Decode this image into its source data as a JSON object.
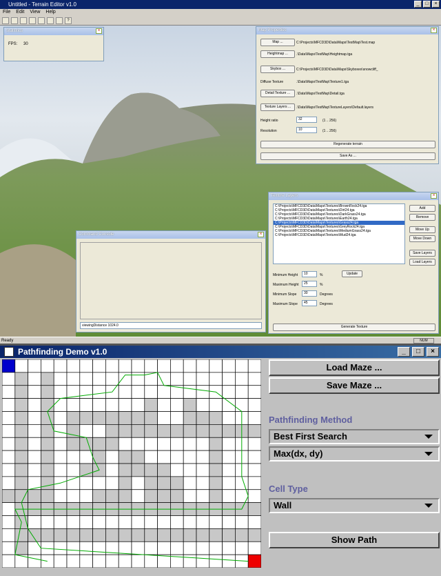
{
  "editor": {
    "title": "Untitled - Terrain Editor v1.0",
    "menu": [
      "File",
      "Edit",
      "View",
      "Help"
    ],
    "status": "Ready",
    "num": "NUM"
  },
  "stats": {
    "title": "Statistics",
    "fps_label": "FPS:",
    "fps_value": "30"
  },
  "props": {
    "title": "Map Properties",
    "map_btn": "Map ...",
    "map_val": "C:\\Projects\\MFCD3D\\Data\\Maps\\TestMap\\Test.map",
    "height_btn": "Heightmap ...",
    "height_val": ".\\Data\\Maps\\TestMap\\Heightmap.tga",
    "sky_btn": "Skybox ...",
    "sky_val": "C:\\Projects\\MFCD3D\\Data\\Maps\\Skyboxes\\snowcliff_",
    "diffuse_lbl": "Diffuse Texture",
    "diffuse_val": ".\\Data\\Maps\\TestMap\\Texture1.tga",
    "detail_btn": "Detail Texture ...",
    "detail_val": ".\\Data\\Maps\\TestMap\\Detail.tga",
    "layers_btn": "Texture Layers ...",
    "layers_val": ".\\Data\\Maps\\TestMap\\TextureLayers\\Default.layers",
    "ratio_lbl": "Height ratio",
    "ratio_val": "32",
    "ratio_range": "(1 .. 256)",
    "res_lbl": "Resolution",
    "res_val": "10",
    "res_range": "(1 .. 256)",
    "regen": "Regenerate terrain",
    "saveas": "Save As ..."
  },
  "layers": {
    "title": "Texture Layers",
    "items": [
      "C:\\Projects\\MFCD3D\\Data\\Maps\\Textures\\BrownRock24.tga",
      "C:\\Projects\\MFCD3D\\Data\\Maps\\Textures\\Dirt24.tga",
      "C:\\Projects\\MFCD3D\\Data\\Maps\\Textures\\DarkGrass24.tga",
      "C:\\Projects\\MFCD3D\\Data\\Maps\\Textures\\Earth24.tga",
      "C:\\Projects\\MFCD3D\\Data\\Maps\\Textures\\Grass24.tga",
      "C:\\Projects\\MFCD3D\\Data\\Maps\\Textures\\GreyRock24.tga",
      "C:\\Projects\\MFCD3D\\Data\\Maps\\Textures\\MediumGrass24.tga",
      "C:\\Projects\\MFCD3D\\Data\\Maps\\Textures\\Mud24.tga"
    ],
    "add": "Add",
    "remove": "Remove",
    "up": "Move Up",
    "down": "Move Down",
    "save": "Save Layers",
    "load": "Load Layers",
    "minh_lbl": "Minimum Height",
    "minh_val": "10",
    "minh_unit": "%",
    "maxh_lbl": "Maximum Height",
    "maxh_val": "25",
    "maxh_unit": "%",
    "mins_lbl": "Minimum Slope",
    "mins_val": "30",
    "mins_unit": "Degrees",
    "maxs_lbl": "Maximum Slope",
    "maxs_val": "45",
    "maxs_unit": "Degrees",
    "update": "Update",
    "generate": "Generate Texture"
  },
  "console": {
    "title": "Command Console",
    "input": "viewingDistance 1024.0"
  },
  "path": {
    "title": "Pathfinding Demo v1.0",
    "load": "Load Maze ...",
    "save": "Save Maze ...",
    "method_lbl": "Pathfinding Method",
    "method": "Best First Search",
    "heuristic": "Max(dx, dy)",
    "cell_lbl": "Cell Type",
    "cell": "Wall",
    "show": "Show Path",
    "grid_cols": 20,
    "grid_rows": 16,
    "walls": [
      "....................",
      ".#.#................",
      ".#.#................",
      ".#.#.......#..#.....",
      ".#.#.#######..###...",
      ".#.#.#..############",
      ".#.#.####.......#...",
      ".#.#...#.##.....#...",
      ".#.#..##.####...#...",
      ".#.#.....#.###..#...",
      "####...###.###..#...",
      ".####################",
      ".#..................",
      ".###################",
      ".#..................",
      "...................."
    ],
    "colors": {
      "start": "#0000cc",
      "goal": "#ee0000",
      "wall": "#c8c8c8",
      "line": "#00aa00"
    }
  }
}
